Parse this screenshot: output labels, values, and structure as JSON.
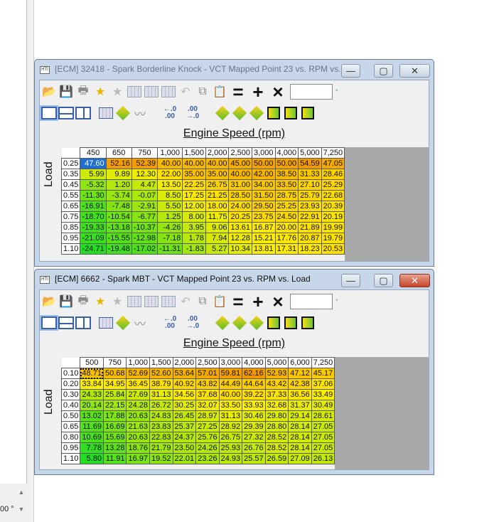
{
  "background": {
    "partial_text": "00 °"
  },
  "colors": {
    "hot": "#f5a000",
    "mid": "#ffee00",
    "cool": "#22e022",
    "selection": "#1f6fd1"
  },
  "windows": [
    {
      "title": "[ECM] 32418 - Spark Borderline Knock - VCT Mapped Point 23 vs. RPM vs. ...",
      "active": false,
      "app_icon": "HTI",
      "x_axis_title": "Engine Speed (rpm)",
      "y_axis_title": "Load",
      "columns": [
        "450",
        "650",
        "750",
        "1,000",
        "1,500",
        "2,000",
        "2,500",
        "3,000",
        "4,000",
        "5,000",
        "7,250"
      ],
      "rows": [
        {
          "load": "0.25",
          "values": [
            "47.60",
            "52.16",
            "52.39",
            "40.00",
            "40.00",
            "40.00",
            "45.00",
            "50.00",
            "50.00",
            "54.59",
            "47.05"
          ]
        },
        {
          "load": "0.35",
          "values": [
            "5.99",
            "9.89",
            "12.30",
            "22.00",
            "35.00",
            "35.00",
            "40.00",
            "42.00",
            "38.50",
            "31.33",
            "28.46"
          ]
        },
        {
          "load": "0.45",
          "values": [
            "-5.32",
            "1.20",
            "4.47",
            "13.50",
            "22.25",
            "26.75",
            "31.00",
            "34.00",
            "33.50",
            "27.10",
            "25.29"
          ]
        },
        {
          "load": "0.55",
          "values": [
            "-11.30",
            "-3.74",
            "-0.07",
            "8.50",
            "17.25",
            "21.25",
            "28.50",
            "31.50",
            "28.75",
            "25.79",
            "22.68"
          ]
        },
        {
          "load": "0.65",
          "values": [
            "-16.91",
            "-7.48",
            "-2.91",
            "5.50",
            "12.00",
            "18.00",
            "24.00",
            "29.50",
            "25.25",
            "23.93",
            "20.39"
          ]
        },
        {
          "load": "0.75",
          "values": [
            "-18.70",
            "-10.54",
            "-6.77",
            "1.25",
            "8.00",
            "11.75",
            "20.25",
            "23.75",
            "24.50",
            "22.91",
            "20.19"
          ]
        },
        {
          "load": "0.85",
          "values": [
            "-19.33",
            "-13.18",
            "-10.37",
            "-4.26",
            "3.95",
            "9.06",
            "13.61",
            "16.87",
            "20.00",
            "21.89",
            "19.99"
          ]
        },
        {
          "load": "0.95",
          "values": [
            "-21.09",
            "-15.55",
            "-12.98",
            "-7.18",
            "1.78",
            "7.94",
            "12.28",
            "15.21",
            "17.76",
            "20.87",
            "19.79"
          ]
        },
        {
          "load": "1.10",
          "values": [
            "-24.71",
            "-19.48",
            "-17.02",
            "-11.31",
            "-1.83",
            "5.27",
            "10.34",
            "13.81",
            "17.31",
            "18.23",
            "20.53"
          ]
        }
      ],
      "selected": {
        "row": 0,
        "col": 0
      }
    },
    {
      "title": "[ECM] 6662 - Spark MBT - VCT Mapped Point 23 vs. RPM vs. Load",
      "active": true,
      "app_icon": "HTI",
      "x_axis_title": "Engine Speed (rpm)",
      "y_axis_title": "Load",
      "columns": [
        "500",
        "750",
        "1,000",
        "1,500",
        "2,000",
        "2,500",
        "3,000",
        "4,000",
        "5,000",
        "6,000",
        "7,250"
      ],
      "rows": [
        {
          "load": "0.10",
          "values": [
            "48.71",
            "50.68",
            "52.69",
            "52.60",
            "53.64",
            "57.01",
            "59.81",
            "62.16",
            "52.93",
            "47.12",
            "45.17"
          ]
        },
        {
          "load": "0.20",
          "values": [
            "33.84",
            "34.95",
            "36.45",
            "38.79",
            "40.92",
            "43.82",
            "44.49",
            "44.64",
            "43.42",
            "42.38",
            "37.06"
          ]
        },
        {
          "load": "0.30",
          "values": [
            "24.33",
            "25.84",
            "27.69",
            "31.13",
            "34.56",
            "37.68",
            "40.00",
            "39.22",
            "37.33",
            "36.56",
            "33.49"
          ]
        },
        {
          "load": "0.40",
          "values": [
            "20.14",
            "22.15",
            "24.28",
            "26.72",
            "30.25",
            "32.07",
            "33.50",
            "33.93",
            "32.68",
            "31.37",
            "30.49"
          ]
        },
        {
          "load": "0.50",
          "values": [
            "13.02",
            "17.88",
            "20.63",
            "24.83",
            "26.45",
            "28.97",
            "31.13",
            "30.46",
            "29.80",
            "29.14",
            "28.61"
          ]
        },
        {
          "load": "0.65",
          "values": [
            "11.69",
            "16.69",
            "21.63",
            "23.83",
            "25.37",
            "27.25",
            "28.92",
            "29.39",
            "28.80",
            "28.14",
            "27.05"
          ]
        },
        {
          "load": "0.80",
          "values": [
            "10.69",
            "15.69",
            "20.63",
            "22.83",
            "24.37",
            "25.76",
            "26.75",
            "27.32",
            "28.52",
            "28.14",
            "27.05"
          ]
        },
        {
          "load": "0.95",
          "values": [
            "7.78",
            "13.28",
            "18.76",
            "21.79",
            "23.50",
            "24.26",
            "25.93",
            "26.76",
            "28.52",
            "28.14",
            "27.05"
          ]
        },
        {
          "load": "1.10",
          "values": [
            "5.80",
            "11.91",
            "16.97",
            "19.52",
            "22.01",
            "23.26",
            "24.93",
            "25.57",
            "26.59",
            "27.09",
            "26.13"
          ]
        }
      ],
      "selected": {
        "row": 0,
        "col": 0
      }
    }
  ]
}
